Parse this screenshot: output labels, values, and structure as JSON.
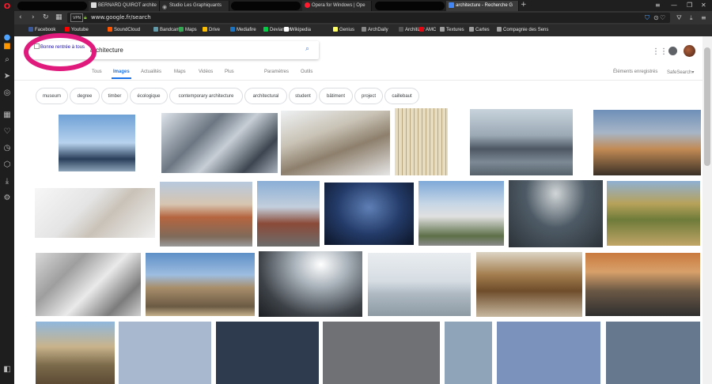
{
  "browser": {
    "tabs": [
      {
        "title": "BERNARD QUIROT archite",
        "icon": "bq-favicon-icon"
      },
      {
        "title": "Studio Les Graphiquants",
        "icon": "eye-icon"
      },
      {
        "title": "Opera for Windows | Ope",
        "icon": "opera-icon"
      },
      {
        "title": "architecture - Recherche G",
        "icon": "google-doc-icon"
      }
    ],
    "new_tab": "+",
    "url": "www.google.fr/search",
    "vpn_label": "VPN",
    "bookmarks": [
      {
        "label": "Facebook",
        "color": "#3b5998"
      },
      {
        "label": "Youtube",
        "color": "#ff0000"
      },
      {
        "label": "SoundCloud",
        "color": "#ff5500"
      },
      {
        "label": "Bandcamp",
        "color": "#629aa9"
      },
      {
        "label": "Maps",
        "color": "#34a853"
      },
      {
        "label": "Drive",
        "color": "#fbbc04"
      },
      {
        "label": "Mediafire",
        "color": "#1e73be"
      },
      {
        "label": "Deviantart",
        "color": "#05cc47"
      },
      {
        "label": "Wikipedia",
        "color": "#ffffff"
      },
      {
        "label": "Genius",
        "color": "#ffff64"
      },
      {
        "label": "ArchDaily",
        "color": "#888888"
      },
      {
        "label": "Architizer",
        "color": "#555555"
      },
      {
        "label": "AMC",
        "color": "#e30613"
      },
      {
        "label": "Textures",
        "color": "#9e9e9e"
      },
      {
        "label": "Cartes",
        "color": "#9e9e9e"
      },
      {
        "label": "Compagnie des Sens",
        "color": "#9e9e9e"
      }
    ]
  },
  "google": {
    "logo_alt": "Bonne rentrée à tous",
    "query": "architecture",
    "nav": {
      "all": "Tous",
      "images": "Images",
      "news": "Actualités",
      "maps": "Maps",
      "videos": "Vidéos",
      "more": "Plus",
      "settings": "Paramètres",
      "tools": "Outils",
      "saved": "Éléments enregistrés",
      "safesearch": "SafeSearch▾"
    },
    "chips": [
      "museum",
      "degree",
      "timber",
      "écologique",
      "contemporary architecture",
      "architectural",
      "student",
      "bâtiment",
      "project",
      "caillebaut"
    ]
  },
  "colors": {
    "annotation_circle": "#e0197d",
    "google_blue": "#1a73e8",
    "opera_red": "#ff1b2d"
  }
}
